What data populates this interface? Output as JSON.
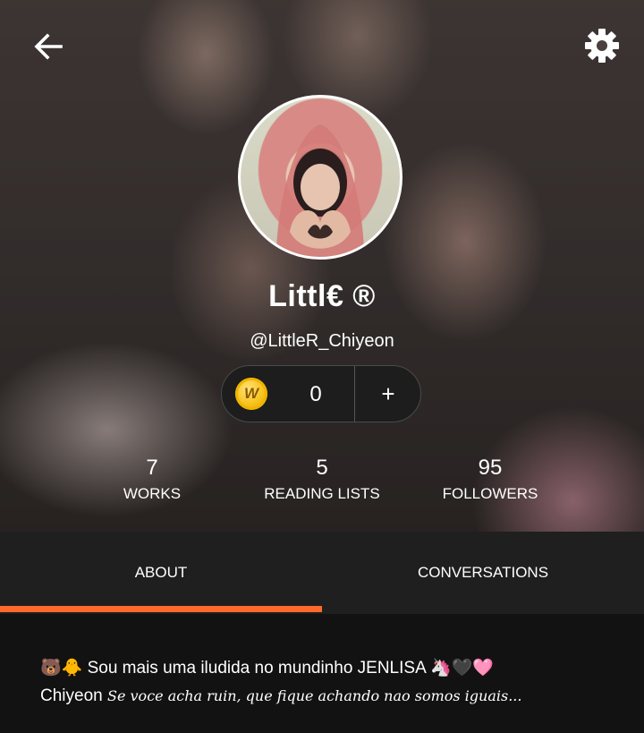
{
  "header": {
    "display_name": "Littl€ ®",
    "username": "@LittleR_Chiyeon",
    "coins": {
      "count": "0",
      "add_label": "+",
      "coin_letter": "W"
    },
    "stats": [
      {
        "value": "7",
        "label": "WORKS"
      },
      {
        "value": "5",
        "label": "READING LISTS"
      },
      {
        "value": "95",
        "label": "FOLLOWERS"
      }
    ]
  },
  "icons": {
    "back": "arrow-left-icon",
    "settings": "gear-icon",
    "coin": "coin-icon"
  },
  "tabs": [
    {
      "label": "ABOUT",
      "active": true
    },
    {
      "label": "CONVERSATIONS",
      "active": false
    }
  ],
  "about": {
    "line1": "🐻🐥 Sou mais uma iludida no mundinho JENLISA 🦄🖤🩷",
    "line2_name": "Chiyeon",
    "line2_script": "Se voce acha ruin, que fique achando nao somos iguais..."
  },
  "colors": {
    "accent": "#ff6a2b",
    "tab_bar": "#1f1f1f",
    "background": "#121212"
  }
}
